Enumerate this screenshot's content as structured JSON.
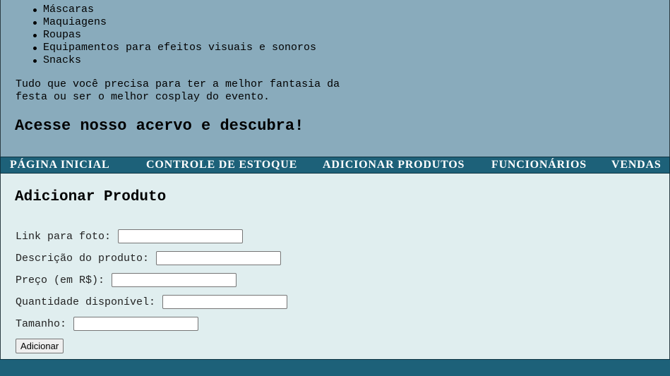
{
  "hero": {
    "items": [
      "Máscaras",
      "Maquiagens",
      "Roupas",
      "Equipamentos para efeitos visuais e sonoros",
      "Snacks"
    ],
    "tagline": "Tudo que você precisa para ter a melhor fantasia da festa ou ser o melhor cosplay do evento.",
    "cta": "Acesse nosso acervo e descubra!"
  },
  "nav": {
    "items": [
      "PÁGINA INICIAL",
      "CONTROLE DE ESTOQUE",
      "ADICIONAR PRODUTOS",
      "FUNCIONÁRIOS",
      "VENDAS"
    ]
  },
  "form": {
    "title": "Adicionar Produto",
    "fields": [
      {
        "label": "Link para foto:",
        "value": ""
      },
      {
        "label": "Descrição do produto:",
        "value": ""
      },
      {
        "label": "Preço (em R$):",
        "value": ""
      },
      {
        "label": "Quantidade disponível:",
        "value": ""
      },
      {
        "label": "Tamanho:",
        "value": ""
      }
    ],
    "submit_label": "Adicionar"
  },
  "colors": {
    "hero_bg": "#89abbc",
    "nav_bg": "#1d6179",
    "main_bg": "#e0eeef"
  }
}
